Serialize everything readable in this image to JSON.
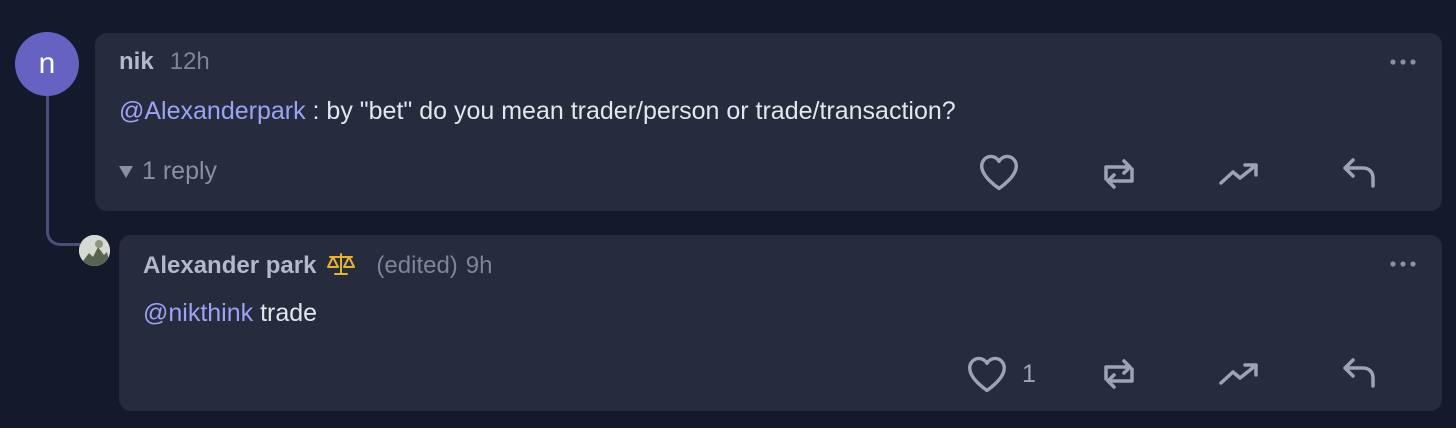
{
  "comment": {
    "avatar_letter": "n",
    "author": "nik",
    "time": "12h",
    "mention": "@Alexanderpark",
    "text": " : by \"bet\" do you mean trader/person or trade/transaction?",
    "replies_label": "1 reply",
    "colors": {
      "avatar": "#6562c2",
      "mention": "#9ea2f2",
      "card": "#262b3e"
    }
  },
  "reply": {
    "author": "Alexander park",
    "badge_icon": "scales-icon",
    "edited": "(edited)",
    "time": "9h",
    "mention": "@nikthink",
    "text": " trade",
    "like_count": "1"
  },
  "icons": [
    "heart-icon",
    "repost-icon",
    "trending-up-icon",
    "reply-arrow-icon",
    "more-dots-icon"
  ]
}
